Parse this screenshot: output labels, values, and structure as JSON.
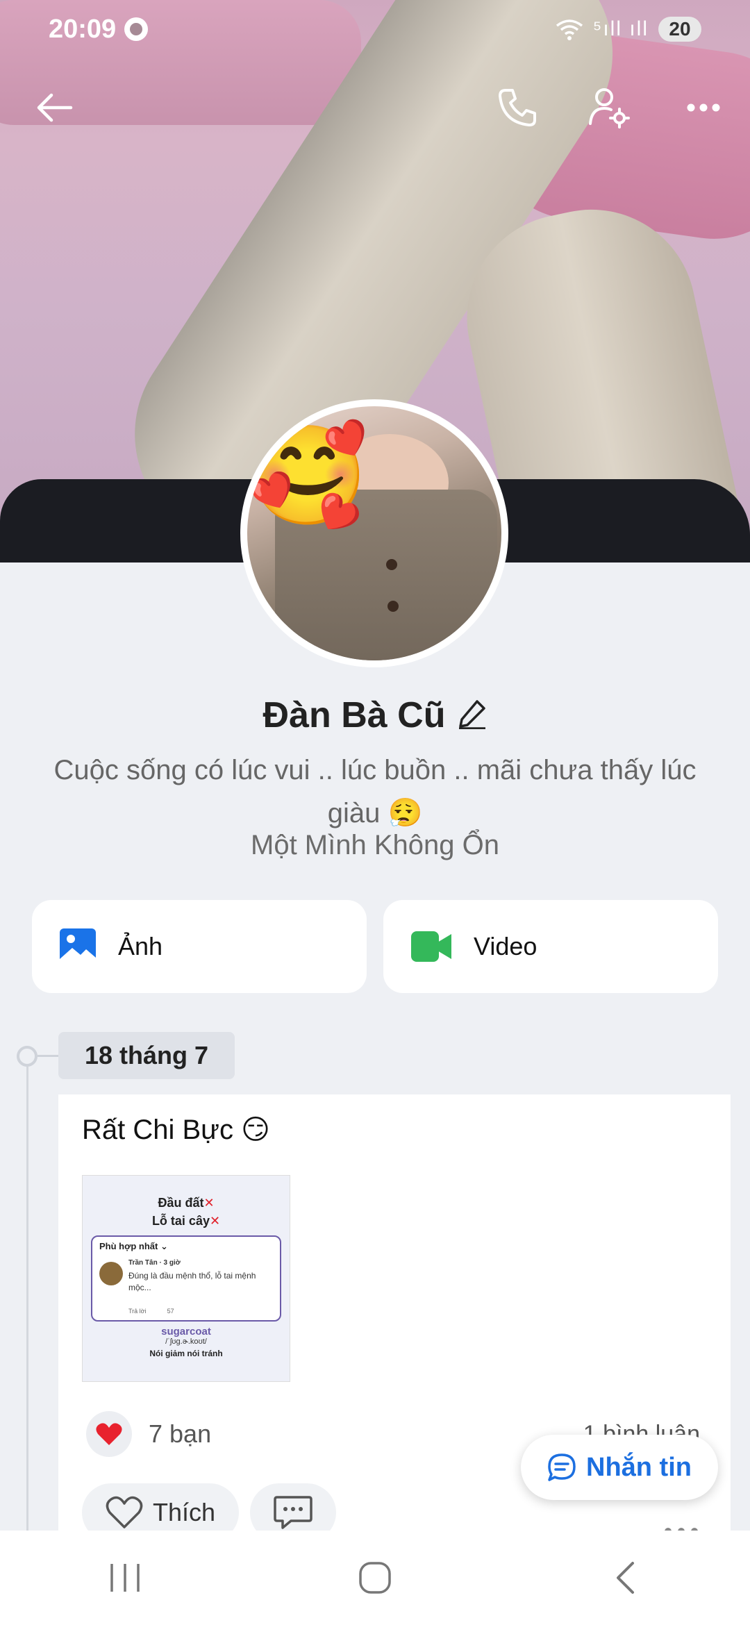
{
  "status_bar": {
    "time": "20:09",
    "signal": "⁵ıll ıll",
    "battery": "20"
  },
  "profile": {
    "name": "Đàn Bà Cũ",
    "bio": "Cuộc sống có lúc vui .. lúc buồn ..  mãi chưa thấy lúc giàu 😮‍💨",
    "subtitle": "Một Mình Không Ổn",
    "avatar_emoji": "🥰"
  },
  "media_tabs": {
    "photos_label": "Ảnh",
    "video_label": "Video"
  },
  "timeline": {
    "date": "18 tháng 7"
  },
  "post": {
    "text": "Rất Chi Bực 😏",
    "thumbnail": {
      "line1": "Đầu đất",
      "line2": "Lỗ tai cây",
      "x_mark": "✕",
      "sort_label": "Phù hợp nhất ⌄",
      "commenter": "Trần Tân · 3 giờ",
      "comment": "Đúng là đầu mệnh thổ, lỗ tai mệnh mộc...",
      "reply_label": "Trả lời",
      "reaction_count": "57",
      "brand": "sugarcoat",
      "ipa": "/ˈʃʊɡ.ɚ.koʊt/",
      "meaning": "Nói giảm nói tránh"
    },
    "reactions_text": "7 bạn",
    "comments_text": "1 bình luận",
    "like_label": "Thích"
  },
  "fab": {
    "label": "Nhắn tin"
  },
  "colors": {
    "accent_blue": "#1c6fe0",
    "photo_icon": "#1a73e8",
    "video_icon": "#34b85a",
    "heart": "#e8222e"
  }
}
